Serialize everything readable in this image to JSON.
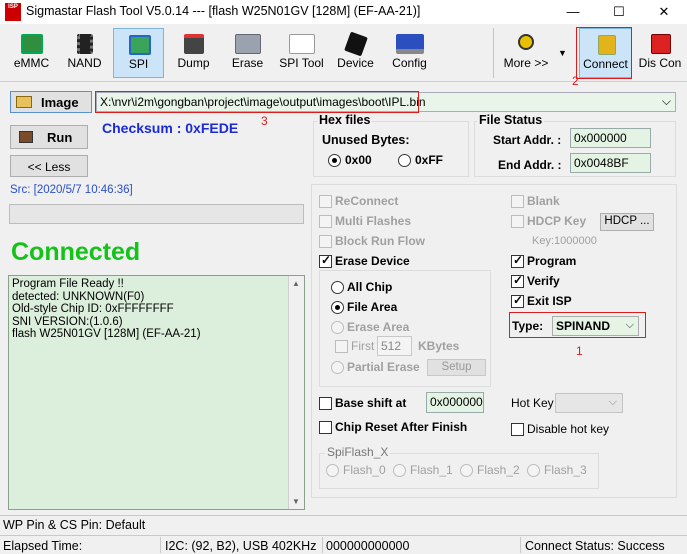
{
  "window": {
    "title": "Sigmastar Flash Tool V5.0.14 --- [flash W25N01GV [128M] (EF-AA-21)]",
    "icon_text": "ISP",
    "minimize": "—",
    "maximize": "☐",
    "close": "✕"
  },
  "toolbar": {
    "emmc": "eMMC",
    "nand": "NAND",
    "spi": "SPI",
    "dump": "Dump",
    "erase": "Erase",
    "spi_tool": "SPI Tool",
    "device": "Device",
    "config": "Config",
    "more": "More >>",
    "more_arrow": "▼",
    "connect": "Connect",
    "dis_con": "Dis Con"
  },
  "annotations": {
    "a1": "1",
    "a2": "2",
    "a3": "3"
  },
  "image": {
    "button": "Image",
    "path": "X:\\nvr\\i2m\\gongban\\project\\image\\output\\images\\boot\\IPL.bin",
    "dropdown_arrow": "⌵"
  },
  "actions": {
    "run": "Run",
    "less": "<< Less"
  },
  "checksum": "Checksum : 0xFEDE",
  "src": "Src: [2020/5/7 10:46:36]",
  "progress_fraction": 0,
  "connected": "Connected",
  "log": [
    "Program File Ready !!",
    "detected: UNKNOWN(F0)",
    "Old-style Chip ID: 0xFFFFFFFF",
    "SNI VERSION:(1.0.6)",
    "flash W25N01GV [128M] (EF-AA-21)"
  ],
  "hex": {
    "title": "Hex files",
    "unused": "Unused Bytes:",
    "opt00": "0x00",
    "optff": "0xFF"
  },
  "filestatus": {
    "title": "File Status",
    "start_label": "Start Addr. :",
    "start_value": "0x000000",
    "end_label": "End Addr. :",
    "end_value": "0x0048BF"
  },
  "options": {
    "reconnect": "ReConnect",
    "multi": "Multi Flashes",
    "blockrun": "Block Run Flow",
    "erasedev": "Erase Device",
    "allchip": "All Chip",
    "filearea": "File Area",
    "erasearea": "Erase Area",
    "first": "First",
    "first_value": "512",
    "kbytes": "KBytes",
    "partial": "Partial Erase",
    "setup": "Setup",
    "blank": "Blank",
    "hdcpkey": "HDCP Key",
    "hdcp_btn": "HDCP ...",
    "key": "Key:1000000",
    "program": "Program",
    "verify": "Verify",
    "exitisp": "Exit ISP",
    "type_label": "Type:",
    "type_value": "SPINAND",
    "type_arrow": "⌵",
    "baseshift": "Base shift at",
    "baseshift_value": "0x000000",
    "chipreset": "Chip Reset After Finish",
    "hotkey": "Hot Key",
    "disablehot": "Disable hot key",
    "spiflash_title": "SpiFlash_X",
    "flash0": "Flash_0",
    "flash1": "Flash_1",
    "flash2": "Flash_2",
    "flash3": "Flash_3"
  },
  "status": {
    "wp": "WP Pin & CS Pin: Default",
    "elapsed": "Elapsed Time:",
    "i2c": "I2C: (92, B2), USB  402KHz",
    "zeros": "000000000000",
    "connect_status": "Connect Status: Success"
  },
  "colors": {
    "checksum": "#1a2bd6",
    "connected": "#14c21a",
    "src": "#2a4fc7",
    "annotation": "#e01b1b",
    "log_bg": "#dcefdc",
    "field_green": "#e4f4e4"
  }
}
